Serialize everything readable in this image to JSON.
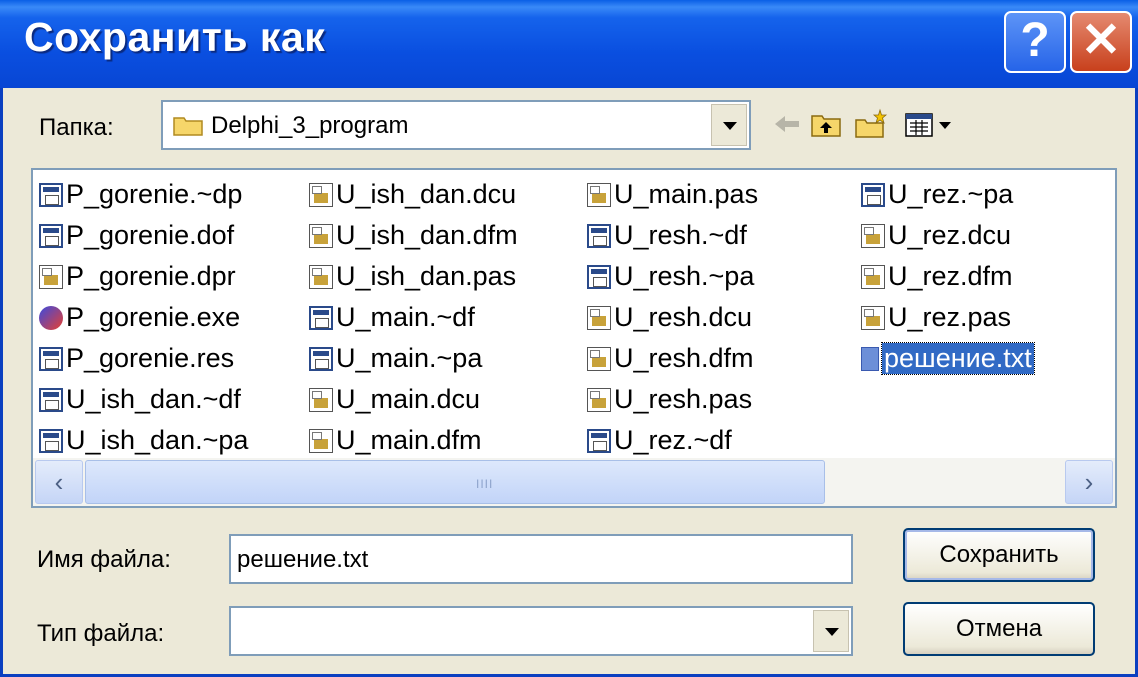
{
  "window": {
    "title": "Сохранить как",
    "help_label": "?",
    "close_label": "✕"
  },
  "folder": {
    "label": "Папка:",
    "value": "Delphi_3_program"
  },
  "toolbar": {
    "back_icon": "arrow-left-icon",
    "up_icon": "folder-up-icon",
    "new_folder_icon": "new-folder-icon",
    "view_icon": "view-menu-icon"
  },
  "files": {
    "columns": [
      [
        {
          "name": "P_gorenie.~dp",
          "icon": "form"
        },
        {
          "name": "P_gorenie.dof",
          "icon": "form"
        },
        {
          "name": "P_gorenie.dpr",
          "icon": "unit"
        },
        {
          "name": "P_gorenie.exe",
          "icon": "exe"
        },
        {
          "name": "P_gorenie.res",
          "icon": "form"
        },
        {
          "name": "U_ish_dan.~df",
          "icon": "form"
        },
        {
          "name": "U_ish_dan.~pa",
          "icon": "form"
        }
      ],
      [
        {
          "name": "U_ish_dan.dcu",
          "icon": "unit"
        },
        {
          "name": "U_ish_dan.dfm",
          "icon": "unit"
        },
        {
          "name": "U_ish_dan.pas",
          "icon": "unit"
        },
        {
          "name": "U_main.~df",
          "icon": "form"
        },
        {
          "name": "U_main.~pa",
          "icon": "form"
        },
        {
          "name": "U_main.dcu",
          "icon": "unit"
        },
        {
          "name": "U_main.dfm",
          "icon": "unit"
        }
      ],
      [
        {
          "name": "U_main.pas",
          "icon": "unit"
        },
        {
          "name": "U_resh.~df",
          "icon": "form"
        },
        {
          "name": "U_resh.~pa",
          "icon": "form"
        },
        {
          "name": "U_resh.dcu",
          "icon": "unit"
        },
        {
          "name": "U_resh.dfm",
          "icon": "unit"
        },
        {
          "name": "U_resh.pas",
          "icon": "unit"
        },
        {
          "name": "U_rez.~df",
          "icon": "form"
        }
      ],
      [
        {
          "name": "U_rez.~pa",
          "icon": "form"
        },
        {
          "name": "U_rez.dcu",
          "icon": "unit"
        },
        {
          "name": "U_rez.dfm",
          "icon": "unit"
        },
        {
          "name": "U_rez.pas",
          "icon": "unit"
        },
        {
          "name": "решение.txt",
          "icon": "txt",
          "selected": true
        }
      ]
    ],
    "scroll_left": "‹",
    "scroll_right": "›",
    "scroll_grip": "IIII"
  },
  "filename": {
    "label": "Имя файла:",
    "value": "решение.txt"
  },
  "filetype": {
    "label": "Тип файла:",
    "value": ""
  },
  "buttons": {
    "save": "Сохранить",
    "cancel": "Отмена"
  }
}
